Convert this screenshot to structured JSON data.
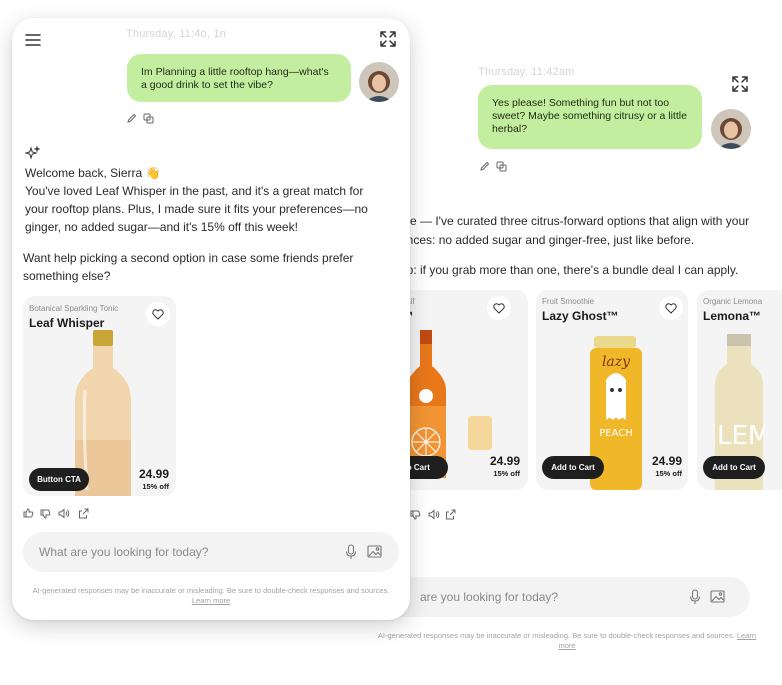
{
  "back": {
    "timestamp": "Thursday, 11:42am",
    "user_message": "Yes please! Something fun but not too sweet? Maybe something citrusy or a little herbal?",
    "ai_line1": "rse — I've curated three citrus-forward options that align with your",
    "ai_line2": "ences: no added sugar and ginger-free, just like before.",
    "ai_line3": "up: if you grab more than one, there's a bundle deal I can apply.",
    "products": [
      {
        "category": "peritif",
        "name": "a™",
        "cta": "to Cart",
        "price": "24.99",
        "discount": "15% off"
      },
      {
        "category": "Fruit Smoothie",
        "name": "Lazy Ghost™",
        "cta": "Add to Cart",
        "price": "24.99",
        "discount": "15% off"
      },
      {
        "category": "Organic Lemona",
        "name": "Lemona™",
        "cta": "Add to Cart"
      }
    ],
    "search_placeholder": "are you looking for today?",
    "disclaimer": "AI-generated responses may be inaccurate or misleading. Be sure to double-check responses and sources.",
    "learn_more": "Learn more"
  },
  "front": {
    "timestamp": "Thursday, 11:4o, 1n",
    "user_message": "Im Planning a little rooftop hang—what's a good drink to set the vibe?",
    "greeting": "Welcome back, Sierra 👋",
    "para1": "You've loved Leaf Whisper in the past, and it's a great match for your rooftop plans. Plus, I made sure it fits your preferences—no ginger, no added sugar—and it's 15% off this week!",
    "para2": "Want help picking a second option in case some friends prefer something else?",
    "product": {
      "category": "Botanical Sparkling Tonic",
      "name": "Leaf Whisper",
      "cta": "Button CTA",
      "price": "24.99",
      "discount": "15% off"
    },
    "search_placeholder": "What are you looking for today?",
    "disclaimer": "AI-generated responses may be inaccurate or misleading. Be sure to double-check responses and sources.",
    "learn_more": "Learn more"
  },
  "colors": {
    "bubble": "#c4ee9f",
    "cta": "#1f1f1f",
    "card": "#f4f4f4",
    "search": "#f3f3f3"
  },
  "icons": [
    "menu-icon",
    "expand-icon",
    "edit-icon",
    "copy-icon",
    "sparkle-icon",
    "heart-icon",
    "thumbs-up-icon",
    "thumbs-down-icon",
    "speaker-icon",
    "share-icon",
    "microphone-icon",
    "image-icon"
  ]
}
